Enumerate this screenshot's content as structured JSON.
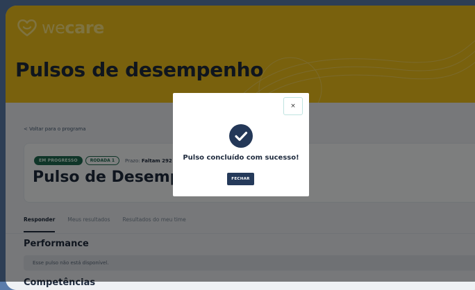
{
  "brand": {
    "logo_light": "we",
    "logo_bold": "care"
  },
  "header": {
    "title": "Pulsos de desempenho"
  },
  "nav": {
    "back_link": "< Voltar para o programa"
  },
  "pulse": {
    "status_badge": "EM PROGRESSO",
    "round_badge": "RODADA 1",
    "deadline_label": "Prazo:",
    "deadline_value": "Faltam 292 dias",
    "title": "Pulso de Desempenho"
  },
  "tabs": [
    {
      "label": "Responder",
      "active": true
    },
    {
      "label": "Meus resultados",
      "active": false
    },
    {
      "label": "Resultados do meu time",
      "active": false
    }
  ],
  "sections": {
    "performance_title": "Performance",
    "performance_notice": "Esse pulso não está disponível.",
    "competencies_title": "Competências"
  },
  "modal": {
    "close_label": "×",
    "message": "Pulso concluído com sucesso!",
    "button_label": "FECHAR"
  },
  "colors": {
    "header_yellow": "#f2c21a",
    "navy": "#1e2a3d",
    "badge_green": "#1f6b51",
    "modal_button": "#253a5a",
    "success_icon": "#243858"
  },
  "icons": {
    "logo": "heart-icon",
    "close": "close-icon",
    "success": "check-circle-icon"
  }
}
